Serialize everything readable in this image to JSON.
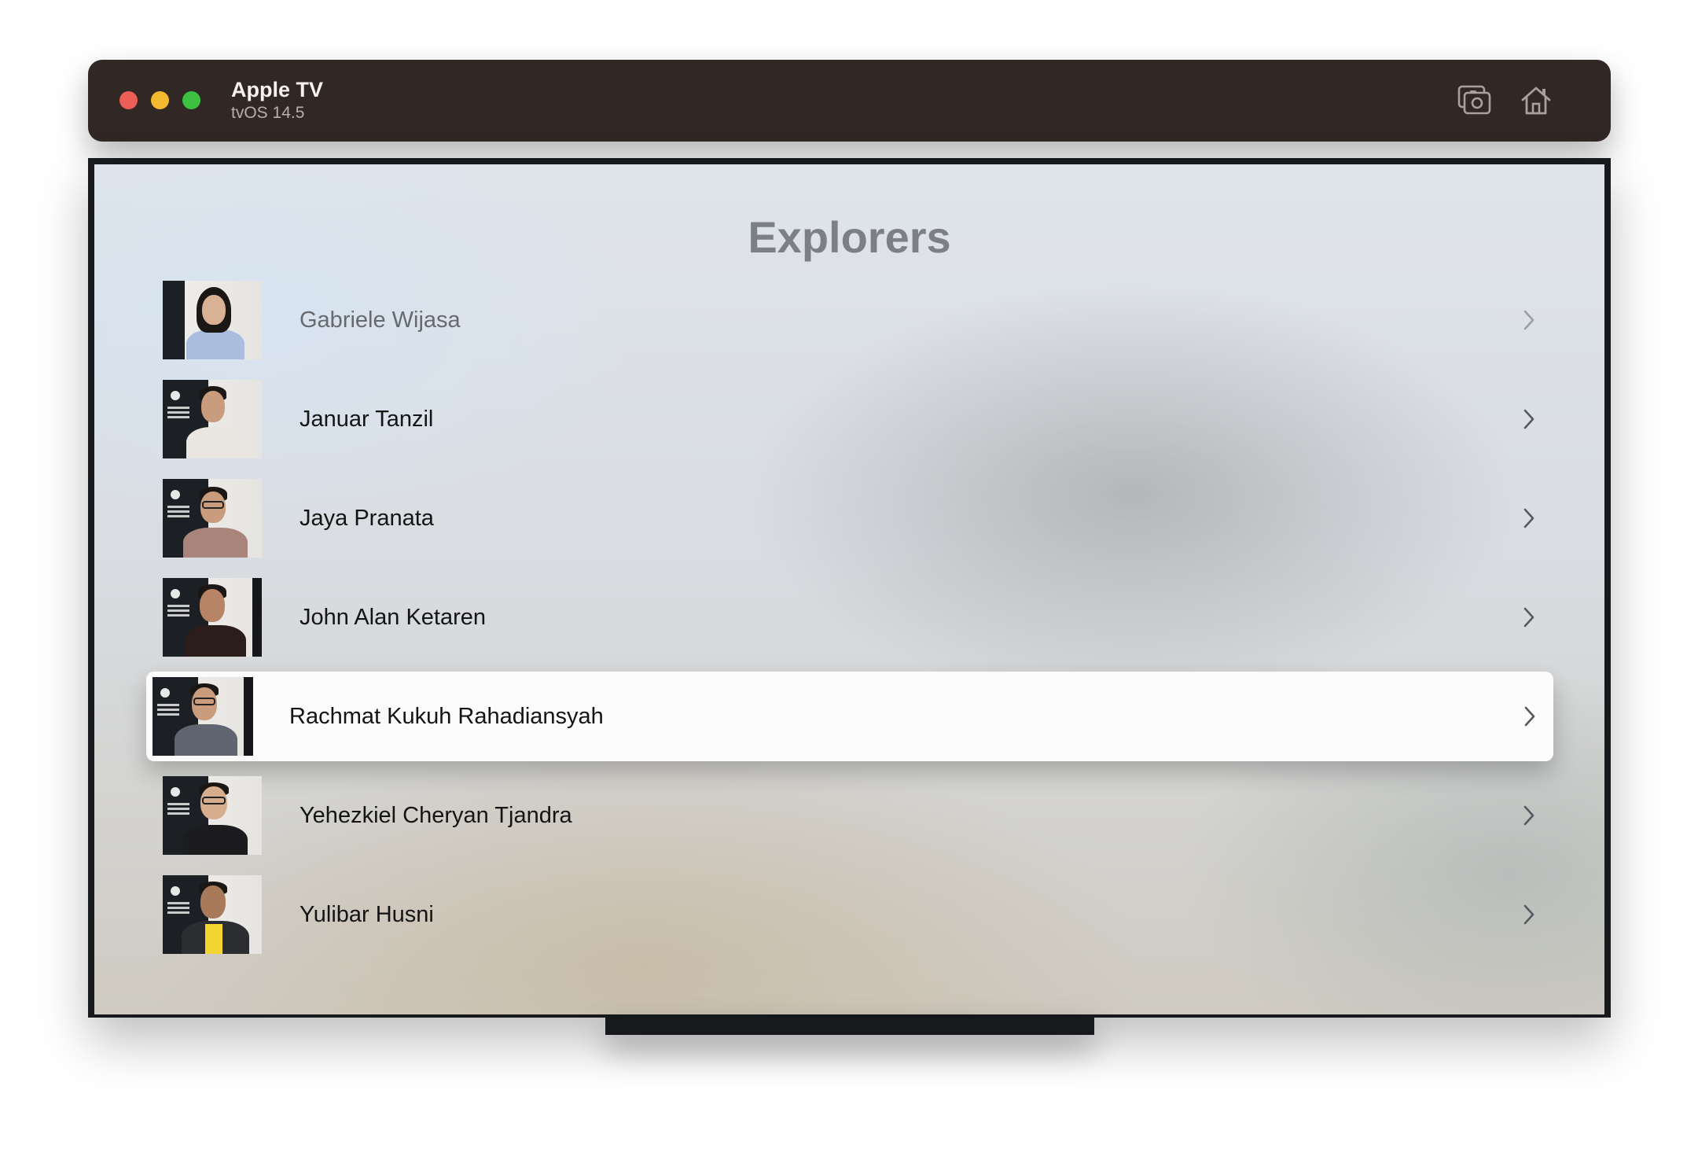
{
  "window": {
    "title": "Apple TV",
    "subtitle": "tvOS 14.5",
    "toolbar": [
      {
        "icon": "screenshot-icon"
      },
      {
        "icon": "home-icon"
      }
    ]
  },
  "screen": {
    "title": "Explorers",
    "rows": [
      {
        "name": "Gabriele Wijasa",
        "focused": false
      },
      {
        "name": "Januar Tanzil",
        "focused": false
      },
      {
        "name": "Jaya Pranata",
        "focused": false
      },
      {
        "name": "John Alan Ketaren",
        "focused": false
      },
      {
        "name": "Rachmat Kukuh Rahadiansyah",
        "focused": true
      },
      {
        "name": "Yehezkiel Cheryan Tjandra",
        "focused": false
      },
      {
        "name": "Yulibar Husni",
        "focused": false
      }
    ]
  },
  "colors": {
    "titlebar": "#312826",
    "close": "#ec5f56",
    "minimize": "#f2b92e",
    "zoom": "#3cc141",
    "focused_row": "#fbfbfb",
    "screen_title": "#7c7f85"
  }
}
